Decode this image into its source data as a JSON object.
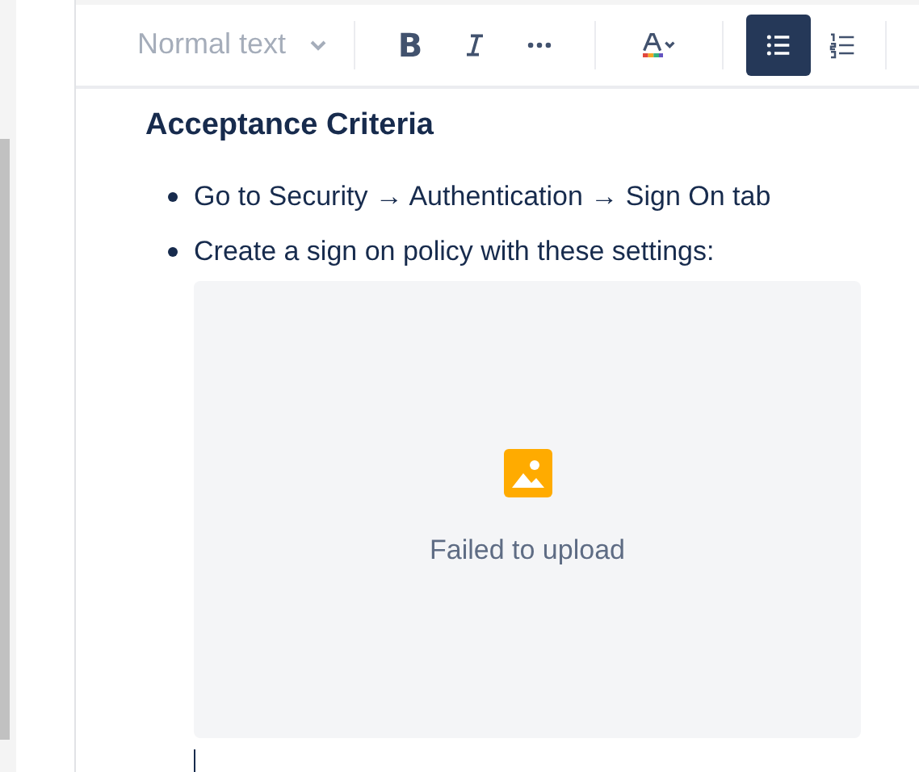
{
  "toolbar": {
    "text_style": "Normal text",
    "buttons": [
      {
        "kind": "bold",
        "label": "B",
        "selected": false
      },
      {
        "kind": "italic",
        "selected": false
      },
      {
        "kind": "more",
        "selected": false
      },
      {
        "kind": "color",
        "selected": false
      },
      {
        "kind": "bullet-list",
        "selected": true
      },
      {
        "kind": "numbered-list",
        "selected": false
      }
    ]
  },
  "content": {
    "heading": "Acceptance Criteria",
    "bullets": [
      "Go to Security → Authentication → Sign On tab",
      "Create a sign on policy with these settings:"
    ],
    "attachment": {
      "status": "Failed to upload"
    }
  }
}
